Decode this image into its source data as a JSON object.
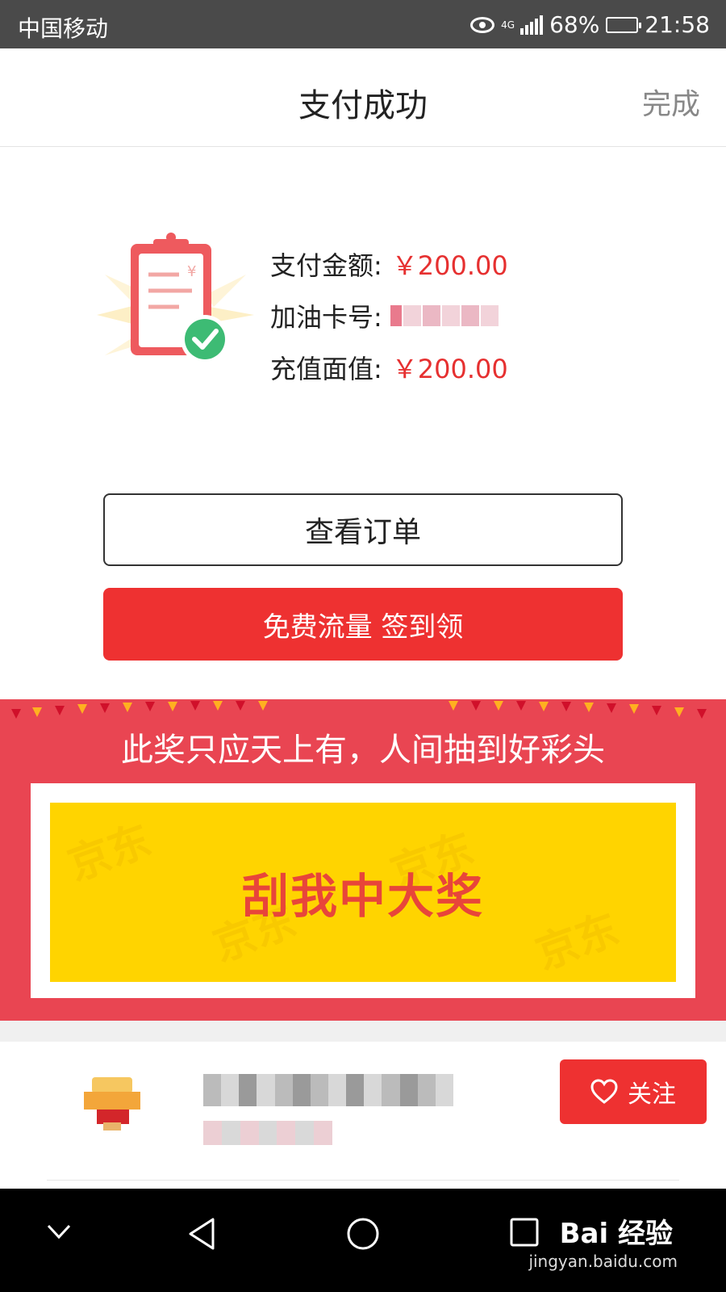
{
  "status_bar": {
    "carrier": "中国移动",
    "network": "4G",
    "battery": "68%",
    "time": "21:58"
  },
  "nav": {
    "title": "支付成功",
    "done_label": "完成"
  },
  "payment": {
    "amount_label": "支付金额:",
    "amount_value": "￥200.00",
    "card_label": "加油卡号:",
    "card_value_masked": "*",
    "face_value_label": "充值面值:",
    "face_value": "￥200.00"
  },
  "actions": {
    "view_order": "查看订单",
    "free_data": "免费流量 签到领"
  },
  "promo": {
    "slogan": "此奖只应天上有，人间抽到好彩头",
    "scratch_text": "刮我中大奖",
    "watermark_text": "京东"
  },
  "shop": {
    "follow_label": "关注"
  },
  "watermark": {
    "brand": "Bai 经验",
    "url": "jingyan.baidu.com"
  },
  "colors": {
    "accent_red": "#ee3131",
    "banner_red": "#e94552",
    "scratch_yellow": "#ffd400",
    "price_red": "#e63030"
  }
}
